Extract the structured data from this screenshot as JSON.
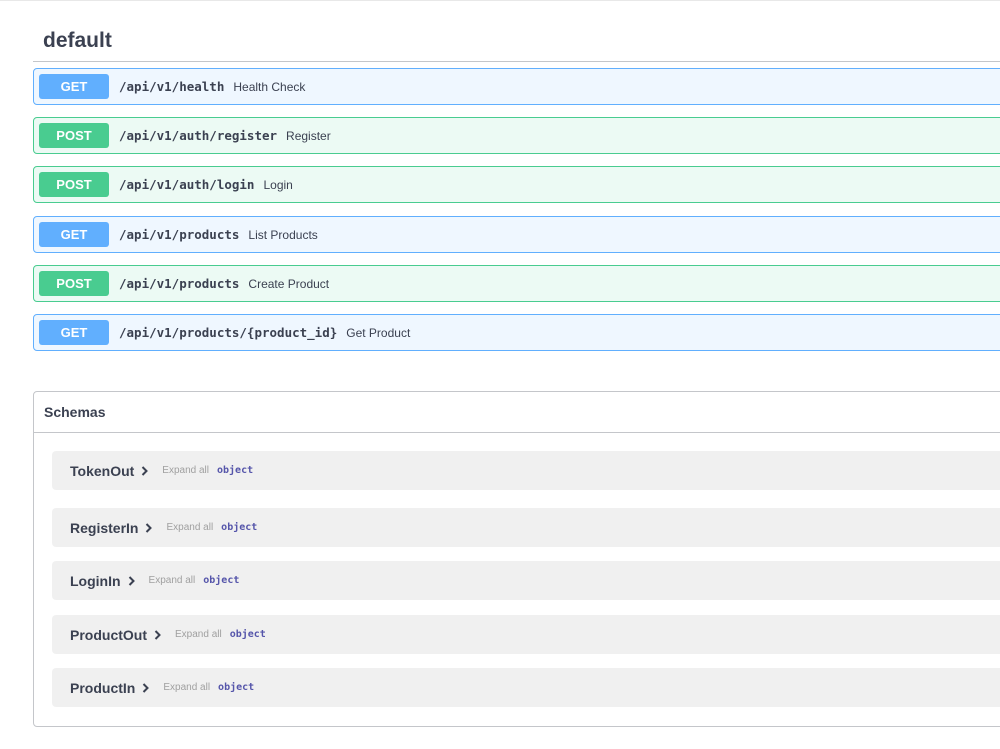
{
  "tag": {
    "title": "default"
  },
  "operations": [
    {
      "method": "GET",
      "path": "/api/v1/health",
      "summary": "Health Check"
    },
    {
      "method": "POST",
      "path": "/api/v1/auth/register",
      "summary": "Register"
    },
    {
      "method": "POST",
      "path": "/api/v1/auth/login",
      "summary": "Login"
    },
    {
      "method": "GET",
      "path": "/api/v1/products",
      "summary": "List Products"
    },
    {
      "method": "POST",
      "path": "/api/v1/products",
      "summary": "Create Product"
    },
    {
      "method": "GET",
      "path": "/api/v1/products/{product_id}",
      "summary": "Get Product"
    }
  ],
  "schemas": {
    "title": "Schemas",
    "items": [
      {
        "name": "TokenOut",
        "expand_label": "Expand all",
        "type": "object"
      },
      {
        "name": "RegisterIn",
        "expand_label": "Expand all",
        "type": "object"
      },
      {
        "name": "LoginIn",
        "expand_label": "Expand all",
        "type": "object"
      },
      {
        "name": "ProductOut",
        "expand_label": "Expand all",
        "type": "object"
      },
      {
        "name": "ProductIn",
        "expand_label": "Expand all",
        "type": "object"
      }
    ]
  },
  "colors": {
    "get": "#61affe",
    "post": "#49cc90",
    "text": "#3b4151",
    "object_type": "#5555aa"
  }
}
